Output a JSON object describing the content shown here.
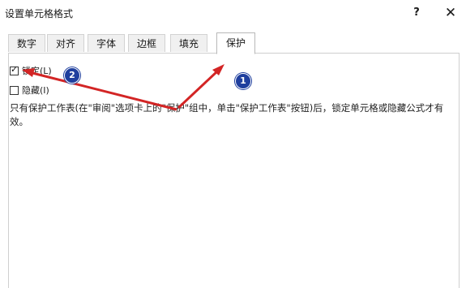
{
  "window": {
    "title": "设置单元格格式",
    "help_label": "?",
    "close_label": "✕"
  },
  "tabs": [
    {
      "label": "数字"
    },
    {
      "label": "对齐"
    },
    {
      "label": "字体"
    },
    {
      "label": "边框"
    },
    {
      "label": "填充"
    },
    {
      "label": "保护",
      "active": true
    }
  ],
  "protection": {
    "locked": {
      "label": "锁定(L)",
      "checked": true
    },
    "hidden": {
      "label": "隐藏(I)",
      "checked": false
    },
    "description": "只有保护工作表(在\"审阅\"选项卡上的\"保护\"组中，单击\"保护工作表\"按钮)后，锁定单元格或隐藏公式才有效。"
  },
  "annotations": {
    "badge_1": "1",
    "badge_2": "2",
    "arrow_color": "#d32525",
    "badge_color": "#1f3f9e"
  }
}
